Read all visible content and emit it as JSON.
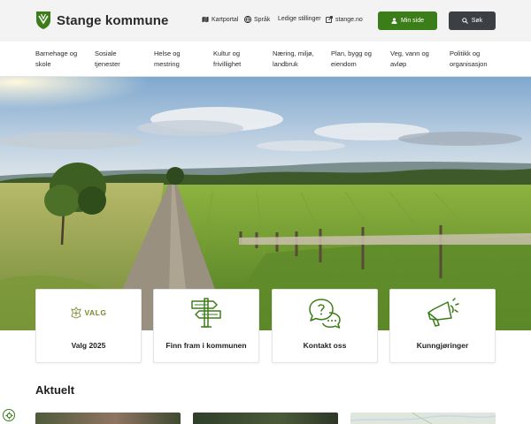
{
  "header": {
    "site_name": "Stange kommune",
    "utility_links": [
      {
        "label": "Kartportal",
        "icon": "map-icon"
      },
      {
        "label": "Språk",
        "icon": "globe-icon"
      },
      {
        "label": "Ledige stillinger",
        "icon": ""
      },
      {
        "label": "stange.no",
        "icon": "external-link-icon"
      }
    ],
    "primary_button": "Min side",
    "search_button": "Søk",
    "colors": {
      "green": "#3b7d18",
      "dark": "#3c3f44",
      "header_bg": "#f3f3f3"
    }
  },
  "nav": {
    "items": [
      {
        "line1": "Barnehage og",
        "line2": "skole"
      },
      {
        "line1": "Sosiale",
        "line2": "tjenester"
      },
      {
        "line1": "Helse og",
        "line2": "mestring"
      },
      {
        "line1": "Kultur og",
        "line2": "frivillighet"
      },
      {
        "line1": "Næring, miljø,",
        "line2": "landbruk"
      },
      {
        "line1": "Plan, bygg og",
        "line2": "eiendom"
      },
      {
        "line1": "Veg, vann og",
        "line2": "avløp"
      },
      {
        "line1": "Politikk og",
        "line2": "organisasjon"
      }
    ]
  },
  "cards": [
    {
      "label": "Valg 2025",
      "icon": "valg-logo-icon",
      "icon_text": "VALG"
    },
    {
      "label": "Finn fram i kommunen",
      "icon": "signpost-icon"
    },
    {
      "label": "Kontakt oss",
      "icon": "chat-bubbles-icon"
    },
    {
      "label": "Kunngjøringer",
      "icon": "megaphone-icon"
    }
  ],
  "section": {
    "title": "Aktuelt"
  }
}
